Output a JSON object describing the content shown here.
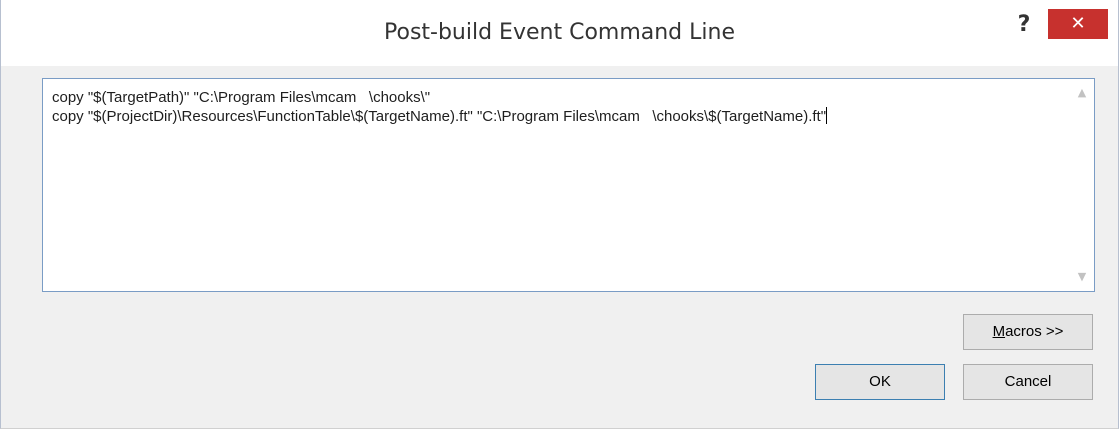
{
  "window": {
    "title": "Post-build Event Command Line",
    "help_label": "?",
    "close_label": "✕"
  },
  "editor": {
    "lines": [
      "copy \"$(TargetPath)\" \"C:\\Program Files\\mcam   \\chooks\\\"",
      "copy \"$(ProjectDir)\\Resources\\FunctionTable\\$(TargetName).ft\" \"C:\\Program Files\\mcam   \\chooks\\$(TargetName).ft\""
    ],
    "scroll_up_icon": "chevron-up-icon",
    "scroll_down_icon": "chevron-down-icon"
  },
  "buttons": {
    "macros_mnemonic": "M",
    "macros_rest": "acros >>",
    "ok_label": "OK",
    "cancel_label": "Cancel"
  },
  "colors": {
    "close_button": "#c7312e",
    "editor_border": "#7a9cc5",
    "default_button_border": "#3c7fb1",
    "panel_background": "#f0f0f0"
  }
}
